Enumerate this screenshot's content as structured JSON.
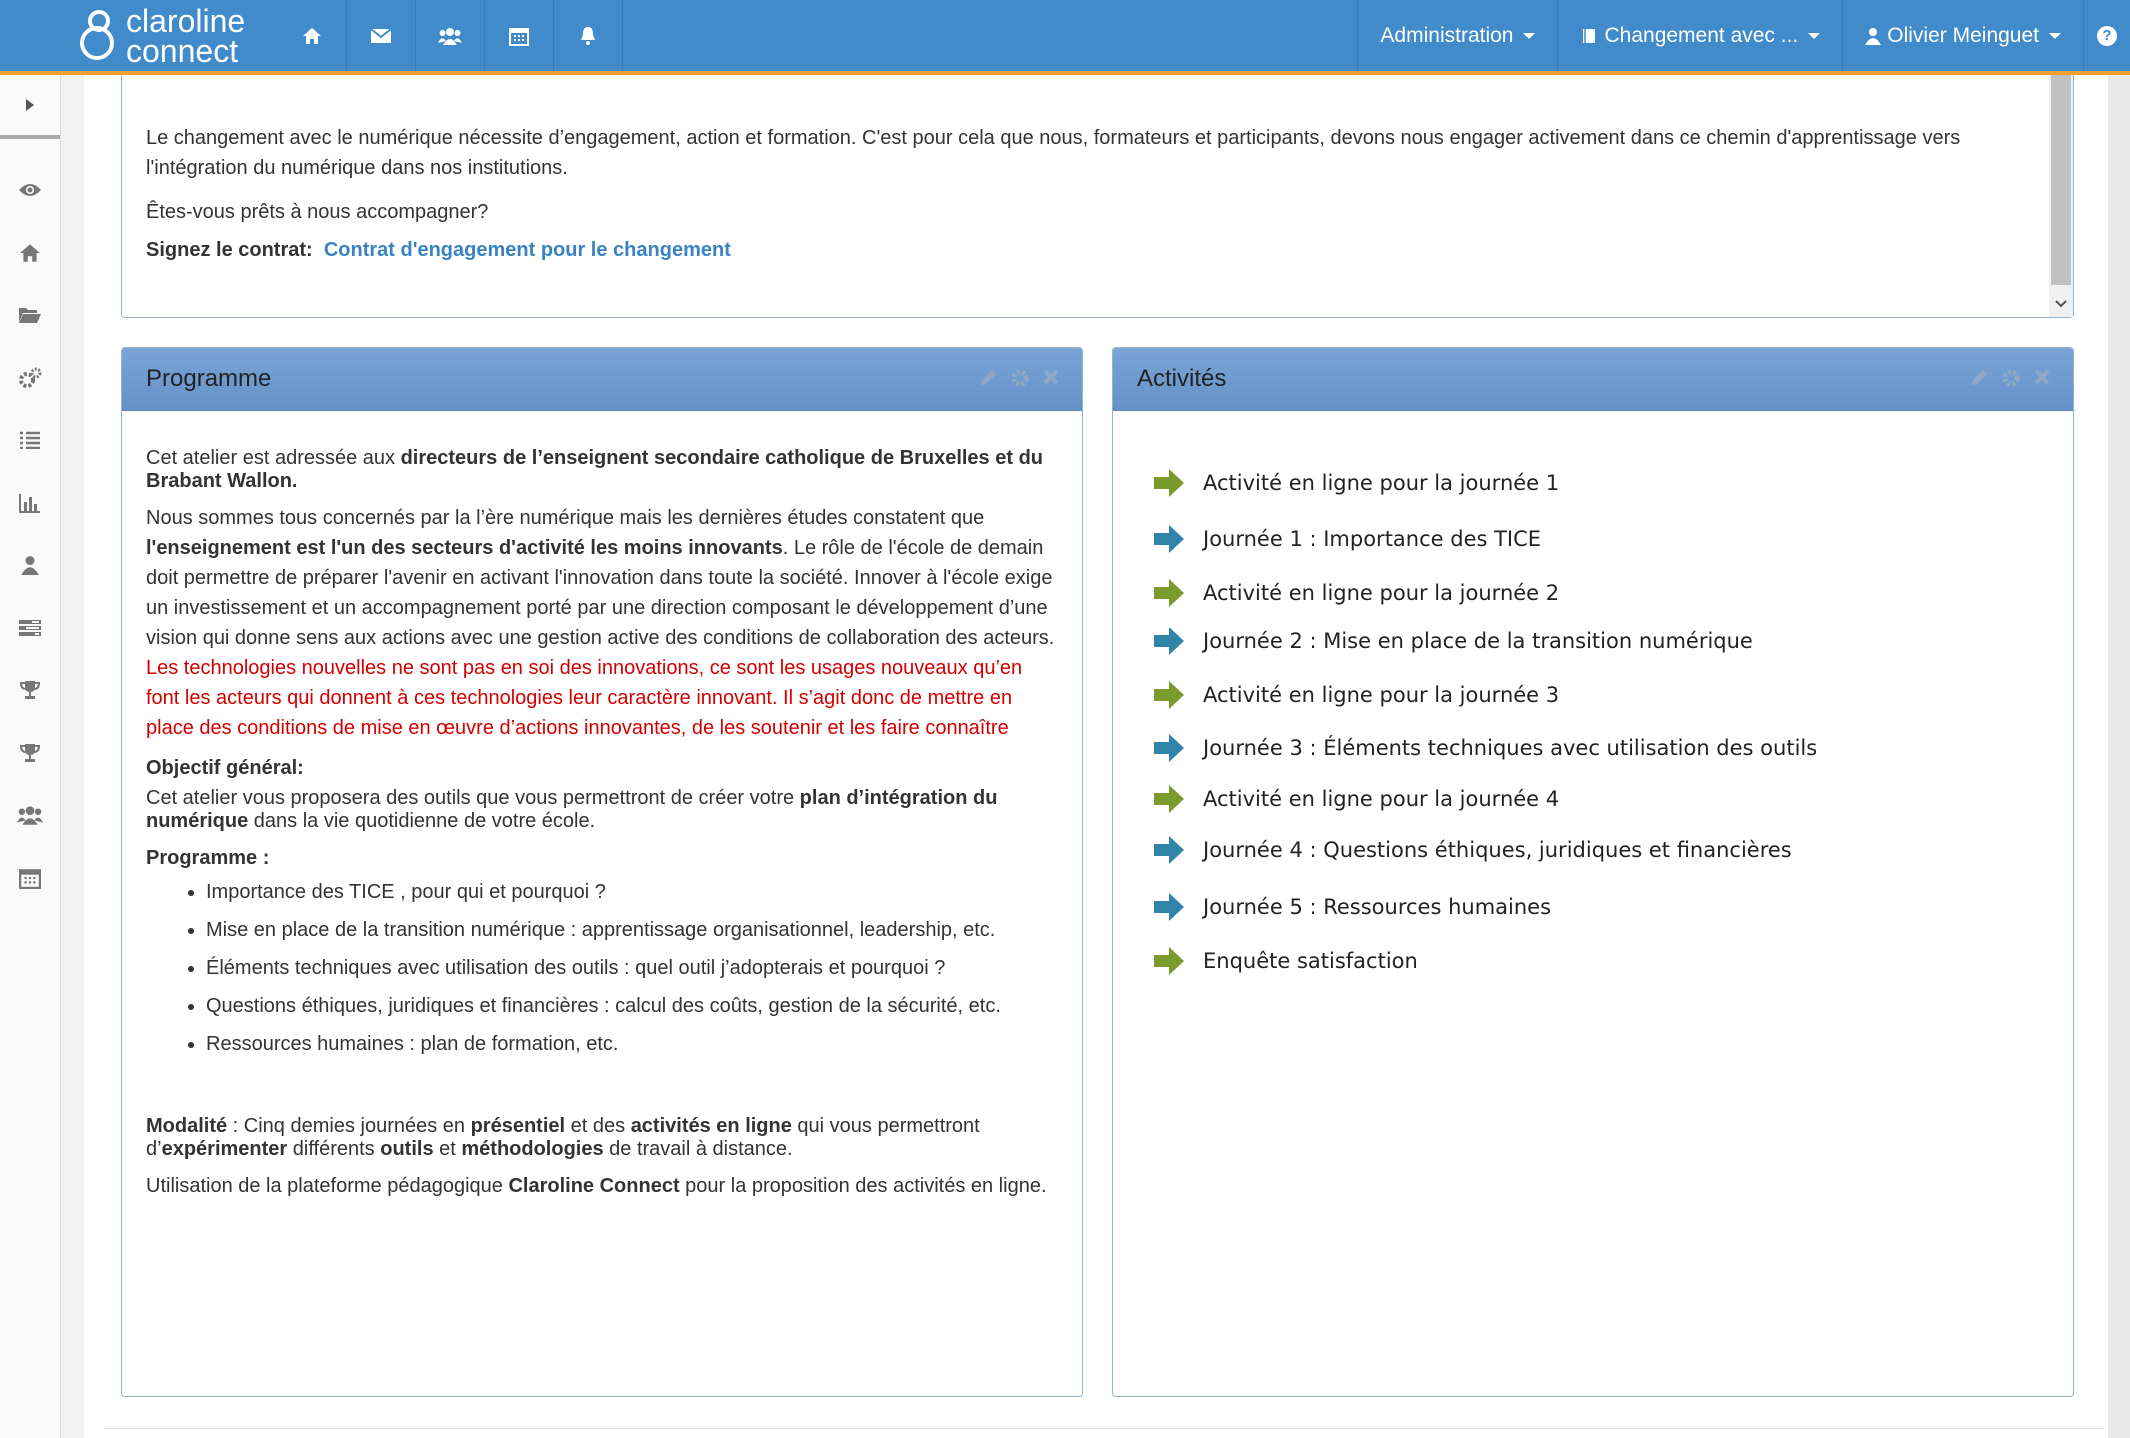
{
  "topbar": {
    "logo_line1": "claroline",
    "logo_line2": "connect",
    "nav_icons": [
      "home-icon",
      "envelope-icon",
      "users-icon",
      "calendar-icon",
      "bell-icon"
    ],
    "menus": {
      "administration": "Administration",
      "workspace": "Changement avec ...",
      "user": "Olivier Meinguet",
      "help": "?"
    },
    "colors": {
      "bar": "#428bca",
      "accent": "#f0a030"
    }
  },
  "sidebar": {
    "icons": [
      "eye-icon",
      "home-icon",
      "folder-open-icon",
      "cogs-icon",
      "list-icon",
      "bar-chart-icon",
      "user-icon",
      "tasks-icon",
      "trophy-icon",
      "trophy-icon",
      "users-icon",
      "calendar-icon"
    ]
  },
  "intro": {
    "paragraph": "Le changement avec le numérique nécessite d’engagement, action et formation. C'est pour cela que nous, formateurs et  participants, devons nous engager activement dans ce chemin d'apprentissage vers l'intégration du numérique dans nos institutions.",
    "question": "Êtes-vous prêts à nous accompagner?",
    "sign_label": "Signez le contrat:",
    "sign_link": "Contrat d'engagement pour le changement"
  },
  "programme": {
    "title": "Programme",
    "p1_a": "Cet atelier est adressée aux ",
    "p1_b": "directeurs de l’enseignent secondaire catholique de Bruxelles et du Brabant Wallon.",
    "p2_a": "Nous sommes tous concernés par la  l’ère numérique  mais les dernières études constatent que ",
    "p2_b": "l'enseignement est l'un des secteurs d'activité les moins innovants",
    "p2_c": ". Le rôle de l'école de demain doit permettre de préparer l'avenir en activant l'innovation dans toute la société. Innover à l'école exige un investissement et un accompagnement porté par une direction composant le développement d’une vision qui donne sens aux actions avec une gestion active des conditions de collaboration des acteurs. ",
    "p2_red": "Les technologies nouvelles ne sont pas en soi des innovations, ce sont les usages nouveaux qu’en font les acteurs qui donnent à ces technologies leur caractère innovant. Il s’agit donc de mettre en place des conditions de mise en œuvre d’actions innovantes, de les soutenir et les faire connaître",
    "objectif_label": "Objectif général:",
    "obj_a": "Cet atelier vous proposera des outils que vous permettront de créer votre ",
    "obj_b": "plan d’intégration du numérique",
    "obj_c": " dans la vie quotidienne de votre école.",
    "programme_label": "Programme :",
    "items": [
      "Importance des TICE , pour qui et pourquoi ?",
      "Mise en place de la transition numérique : apprentissage organisationnel, leadership, etc.",
      "Éléments techniques avec utilisation des outils : quel outil j’adopterais et pourquoi ?",
      "Questions éthiques, juridiques et financières : calcul des coûts, gestion de la sécurité, etc.",
      "Ressources humaines : plan de formation, etc."
    ],
    "mod_1": "Modalité",
    "mod_2": " : Cinq demies journées en ",
    "mod_3": "présentiel",
    "mod_4": "  et des ",
    "mod_5": "activités en ligne",
    "mod_6": " qui vous permettront d’",
    "mod_7": "expérimenter",
    "mod_8": " différents ",
    "mod_9": "outils",
    "mod_10": " et ",
    "mod_11": "méthodologies",
    "mod_12": " de travail à distance.",
    "util_a": "Utilisation de la plateforme pédagogique ",
    "util_b": "Claroline Connect",
    "util_c": " pour la proposition des activités en ligne."
  },
  "activites": {
    "title": "Activités",
    "items": [
      {
        "label": "Activité en ligne pour la journée 1",
        "color": "#7a9a2e"
      },
      {
        "label": "Journée 1 : Importance des TICE",
        "color": "#2f84a8"
      },
      {
        "label": "Activité en ligne pour la journée 2",
        "color": "#7a9a2e"
      },
      {
        "label": "Journée 2 : Mise en place de la transition numérique",
        "color": "#2f84a8"
      },
      {
        "label": "Activité en ligne pour la journée 3",
        "color": "#7a9a2e"
      },
      {
        "label": "Journée 3 : Éléments techniques avec utilisation des outils",
        "color": "#2f84a8"
      },
      {
        "label": "Activité en ligne pour la journée 4",
        "color": "#7a9a2e"
      },
      {
        "label": "Journée 4 : Questions éthiques, juridiques et financières",
        "color": "#2f84a8"
      },
      {
        "label": "Journée 5 : Ressources humaines",
        "color": "#2f84a8"
      },
      {
        "label": "Enquête satisfaction",
        "color": "#7a9a2e"
      }
    ]
  }
}
